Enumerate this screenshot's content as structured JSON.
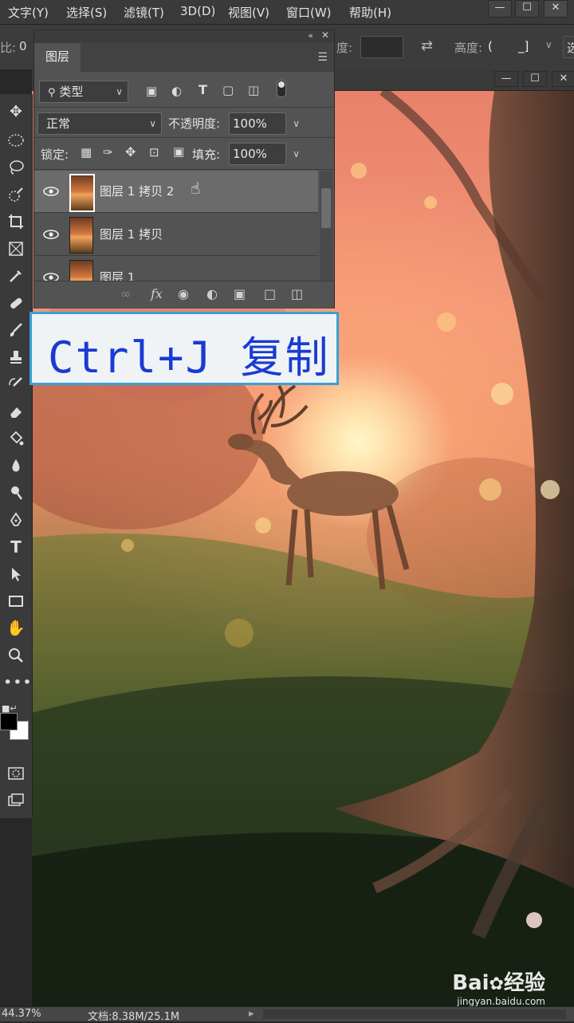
{
  "menu": {
    "items": [
      "文字(Y)",
      "选择(S)",
      "滤镜(T)",
      "3D(D)",
      "视图(V)",
      "窗口(W)",
      "帮助(H)"
    ]
  },
  "options_bar": {
    "left_label": "比:",
    "left_value": "0",
    "width_suffix": "度:",
    "height_label": "高度:",
    "height_value": "(",
    "right_label": "选"
  },
  "layers_panel": {
    "tab": "图层",
    "filter_type": "类型",
    "blend_mode": "正常",
    "opacity_label": "不透明度:",
    "opacity_value": "100%",
    "lock_label": "锁定:",
    "fill_label": "填充:",
    "fill_value": "100%",
    "layers": [
      {
        "name": "图层 1 拷贝 2",
        "selected": true
      },
      {
        "name": "图层 1 拷贝",
        "selected": false
      },
      {
        "name": "图层 1",
        "selected": false
      }
    ],
    "footer_icons": [
      "link-icon",
      "fx-icon",
      "mask-icon",
      "adjustment-icon",
      "folder-icon",
      "new-layer-icon",
      "trash-icon"
    ]
  },
  "caption": {
    "text": "Ctrl+J 复制"
  },
  "status_bar": {
    "zoom": "44.37%",
    "doc_info": "文档:8.38M/25.1M"
  },
  "watermark": {
    "brand": "Bai",
    "brand_cn": "经验",
    "url": "jingyan.baidu.com"
  },
  "colors": {
    "accent_border": "#37a0d8",
    "caption_text": "#1a3ad3",
    "panel_bg": "#535353",
    "selected_layer": "#6b6b6b"
  }
}
